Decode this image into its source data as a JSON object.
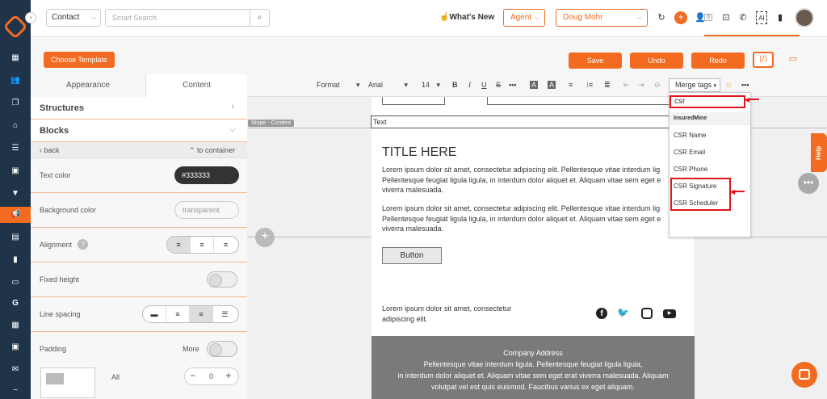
{
  "topbar": {
    "contact_select": "Contact",
    "search_placeholder": "Smart Search",
    "whats_new": "What's New",
    "agent_select": "Agent",
    "user_select": "Doug Mohr",
    "badge_count": "0"
  },
  "toolbar": {
    "choose_template": "Choose Template",
    "save": "Save",
    "undo": "Undo",
    "redo": "Redo"
  },
  "panel": {
    "tabs": [
      "Appearance",
      "Content"
    ],
    "structures": "Structures",
    "blocks": "Blocks",
    "back": "back",
    "to_container": "to container",
    "text_color_label": "Text color",
    "text_color_value": "#333333",
    "bg_color_label": "Background color",
    "bg_color_value": "transparent",
    "alignment_label": "Alignment",
    "fixed_height_label": "Fixed height",
    "line_spacing_label": "Line spacing",
    "padding_label": "Padding",
    "padding_more": "More",
    "padding_all": "All",
    "padding_value": "0"
  },
  "editor": {
    "format": "Format",
    "font": "Arial",
    "size": "14",
    "merge_tags": "Merge tags",
    "stripe_label": "Stripe - Content",
    "text_label": "Text"
  },
  "email": {
    "title": "TITLE HERE",
    "para1": "Lorem ipsum dolor sit amet, consectetur adipiscing elit. Pellentesque vitae interdum lig",
    "para1b": "Pellentesque feugiat ligula ligula, in interdum dolor aliquet et. Aliquam vitae sem eget e",
    "para1c": "viverra malesuada.",
    "para2": "Lorem ipsum dolor sit amet, consectetur adipiscing elit. Pellentesque vitae interdum lig",
    "para2b": "Pellentesque feugiat ligula ligula, in interdum dolor aliquet et. Aliquam vitae sem eget e",
    "para2c": "viverra malesuada.",
    "button": "Button",
    "footer_text1": "Lorem ipsum dolor sit amet, consectetur",
    "footer_text2": "adipiscing elit.",
    "company_address": "Company Address",
    "addr1": "Pellentesque vitae interdum ligula. Pellentesque feugiat ligula ligula,",
    "addr2": "in interdum dolor aliquet et. Aliquam vitae sem eget erat viverra malesuada. Aliquam",
    "addr3": "volutpat vel est quis euismod. Faucibus varius ex eget aliquam."
  },
  "merge_dropdown": {
    "search_value": "csr",
    "group": "InsuredMine",
    "items": [
      "CSR Name",
      "CSR Email",
      "CSR Phone",
      "CSR Signature",
      "CSR Scheduler"
    ]
  },
  "help": "Help",
  "colors": {
    "accent": "#f26b21",
    "sidebar": "#1f3349",
    "highlight": "#e0141e"
  }
}
